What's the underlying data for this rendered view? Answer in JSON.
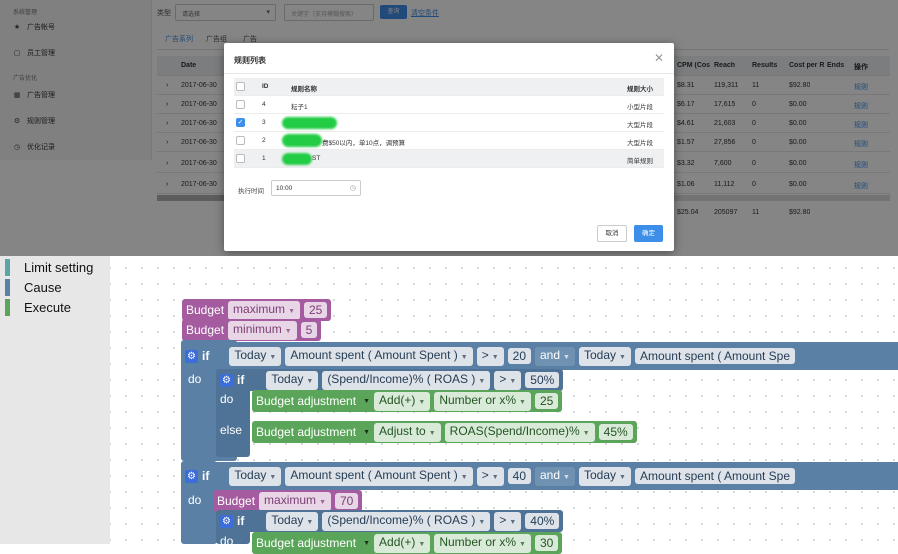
{
  "sidebar": {
    "group_system": "系统管理",
    "items_system": [
      {
        "icon": "star-icon",
        "label": "广告帐号"
      },
      {
        "icon": "document-icon",
        "label": "员工管理"
      }
    ],
    "group_opt": "广告优化",
    "items_opt": [
      {
        "icon": "grid-icon",
        "label": "广告管理"
      },
      {
        "icon": "gear-icon",
        "label": "规则管理"
      },
      {
        "icon": "clock-icon",
        "label": "优化记录"
      }
    ]
  },
  "filters": {
    "type_label": "类型",
    "type_select": "请选择",
    "keyword_placeholder": "关键字（支持模糊搜索）",
    "query_button": "查询",
    "clear_link": "清空条件"
  },
  "tabs": [
    "广告系列",
    "广告组",
    "广告"
  ],
  "grid": {
    "columns": [
      "Date",
      "CPM (Cos",
      "Reach",
      "Results",
      "Cost per R",
      "Ends",
      "操作"
    ],
    "rows": [
      {
        "date": "2017-06-30",
        "cpm": "$8.31",
        "reach": "119,311",
        "results": "11",
        "cost": "$92.80",
        "action": "规则"
      },
      {
        "date": "2017-06-30",
        "cpm": "$6.17",
        "reach": "17,615",
        "results": "0",
        "cost": "$0.00",
        "action": "规则"
      },
      {
        "date": "2017-06-30",
        "cpm": "$4.61",
        "reach": "21,603",
        "results": "0",
        "cost": "$0.00",
        "action": "规则"
      },
      {
        "date": "2017-06-30",
        "cpm": "$1.57",
        "reach": "27,856",
        "results": "0",
        "cost": "$0.00",
        "action": "规则"
      },
      {
        "date": "2017-06-30",
        "cpm": "$3.32",
        "reach": "7,600",
        "results": "0",
        "cost": "$0.00",
        "action": "规则"
      },
      {
        "date": "2017-06-30",
        "cpm": "$1.06",
        "reach": "11,112",
        "results": "0",
        "cost": "$0.00",
        "action": "规则"
      }
    ],
    "total": {
      "cpm": "$25.04",
      "reach": "205097",
      "results": "11",
      "cost": "$92.80"
    }
  },
  "modal": {
    "title": "规则列表",
    "columns": {
      "id": "ID",
      "name": "规则名称",
      "size": "规则大小"
    },
    "rows": [
      {
        "id": "4",
        "name": "耘子1",
        "size": "小型片段",
        "checked": false
      },
      {
        "id": "3",
        "name": "",
        "size": "大型片段",
        "checked": true
      },
      {
        "id": "2",
        "name": "费$50以内，单10点，调预算",
        "size": "大型片段",
        "checked": false
      },
      {
        "id": "1",
        "name": "ST",
        "size": "简单规则",
        "checked": false
      }
    ],
    "time_label": "执行时间",
    "time_value": "10:00",
    "cancel": "取消",
    "confirm": "确定"
  },
  "categories": [
    {
      "label": "Limit setting",
      "color": "#5ba5a5"
    },
    {
      "label": "Cause",
      "color": "#5b80a5"
    },
    {
      "label": "Execute",
      "color": "#5ba55b"
    }
  ],
  "blocks": {
    "b1": {
      "name": "Budget",
      "type": "maximum",
      "value": "25"
    },
    "b2": {
      "name": "Budget",
      "type": "minimum",
      "value": "5"
    },
    "if1": {
      "kw": "if",
      "period": "Today",
      "metric": "Amount spent ( Amount Spent )",
      "op": ">",
      "value": "20",
      "join": "and",
      "period2": "Today",
      "metric2": "Amount spent ( Amount Spe"
    },
    "do": "do",
    "else": "else",
    "inner_if1": {
      "kw": "if",
      "period": "Today",
      "metric": "(Spend/Income)% ( ROAS )",
      "op": ">",
      "value": "50%"
    },
    "adj1": {
      "name": "Budget adjustment",
      "action": "Add(+)",
      "mode": "Number or x%",
      "value": "25"
    },
    "adj2": {
      "name": "Budget adjustment",
      "action": "Adjust to",
      "mode": "ROAS(Spend/Income)%",
      "value": "45%"
    },
    "if2": {
      "kw": "if",
      "period": "Today",
      "metric": "Amount spent ( Amount Spent )",
      "op": ">",
      "value": "40",
      "join": "and",
      "period2": "Today",
      "metric2": "Amount spent ( Amount Spe"
    },
    "b3": {
      "name": "Budget",
      "type": "maximum",
      "value": "70"
    },
    "inner_if2": {
      "kw": "if",
      "period": "Today",
      "metric": "(Spend/Income)% ( ROAS )",
      "op": ">",
      "value": "40%"
    },
    "adj3": {
      "name": "Budget adjustment",
      "action": "Add(+)",
      "mode": "Number or x%",
      "value": "30"
    }
  }
}
